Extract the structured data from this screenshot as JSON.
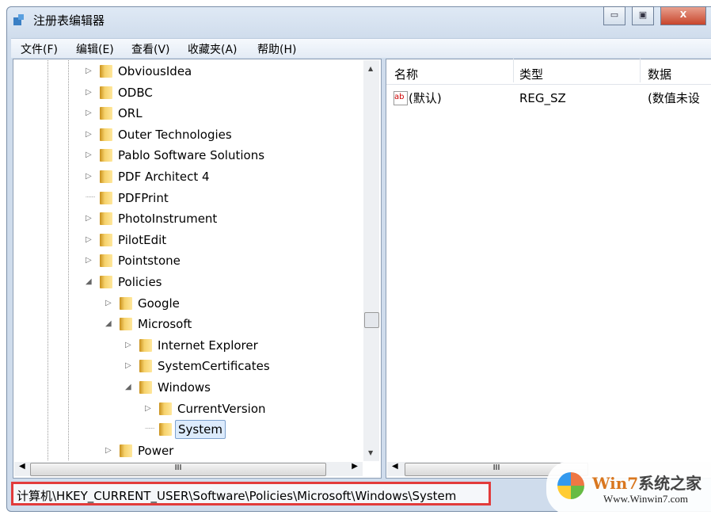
{
  "window": {
    "title": "注册表编辑器",
    "controls": [
      "minimize",
      "maximize",
      "close"
    ]
  },
  "menu": [
    "文件(F)",
    "编辑(E)",
    "查看(V)",
    "收藏夹(A)",
    "帮助(H)"
  ],
  "tree": [
    {
      "label": "ObviousIdea",
      "level": 0,
      "expander": "collapsed"
    },
    {
      "label": "ODBC",
      "level": 0,
      "expander": "collapsed"
    },
    {
      "label": "ORL",
      "level": 0,
      "expander": "collapsed"
    },
    {
      "label": "Outer Technologies",
      "level": 0,
      "expander": "collapsed"
    },
    {
      "label": "Pablo Software Solutions",
      "level": 0,
      "expander": "collapsed"
    },
    {
      "label": "PDF Architect 4",
      "level": 0,
      "expander": "collapsed"
    },
    {
      "label": "PDFPrint",
      "level": 0,
      "expander": "none"
    },
    {
      "label": "PhotoInstrument",
      "level": 0,
      "expander": "collapsed"
    },
    {
      "label": "PilotEdit",
      "level": 0,
      "expander": "collapsed"
    },
    {
      "label": "Pointstone",
      "level": 0,
      "expander": "collapsed"
    },
    {
      "label": "Policies",
      "level": 0,
      "expander": "expanded"
    },
    {
      "label": "Google",
      "level": 1,
      "expander": "collapsed"
    },
    {
      "label": "Microsoft",
      "level": 1,
      "expander": "expanded"
    },
    {
      "label": "Internet Explorer",
      "level": 2,
      "expander": "collapsed"
    },
    {
      "label": "SystemCertificates",
      "level": 2,
      "expander": "collapsed"
    },
    {
      "label": "Windows",
      "level": 2,
      "expander": "expanded"
    },
    {
      "label": "CurrentVersion",
      "level": 3,
      "expander": "collapsed"
    },
    {
      "label": "System",
      "level": 3,
      "expander": "none",
      "selected": true
    },
    {
      "label": "Power",
      "level": 1,
      "expander": "collapsed"
    }
  ],
  "list": {
    "columns": [
      "名称",
      "类型",
      "数据"
    ],
    "rows": [
      {
        "name": "(默认)",
        "type": "REG_SZ",
        "data": "(数值未设置)"
      }
    ]
  },
  "scrollbar_glyph": "III",
  "status": "计算机\\HKEY_CURRENT_USER\\Software\\Policies\\Microsoft\\Windows\\System",
  "watermark": {
    "brand": "Win7系统之家",
    "url": "Www.Winwin7.com"
  },
  "colors": {
    "status_highlight": "#e23b3b",
    "selection": "#dcebfc"
  }
}
